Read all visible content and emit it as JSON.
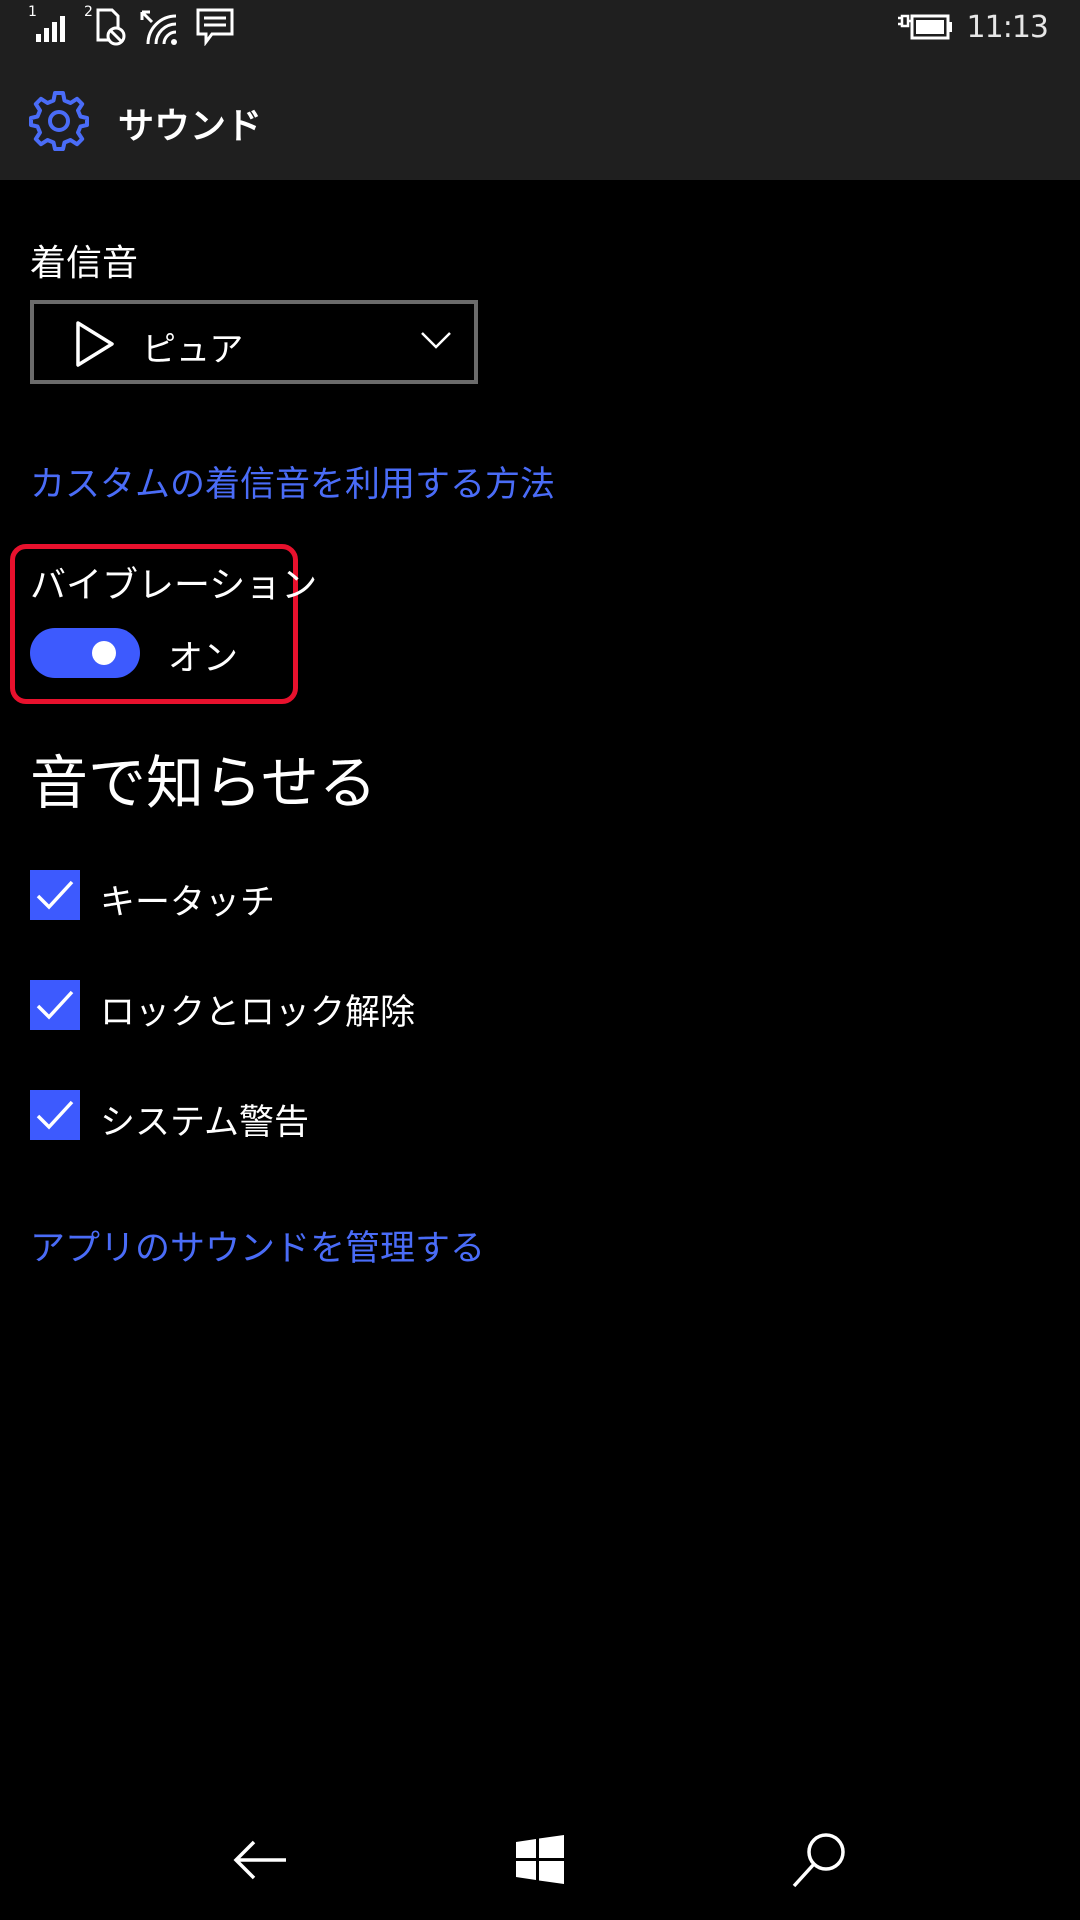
{
  "status_bar": {
    "sim1_label": "1",
    "sim2_label": "2",
    "time": "11:13",
    "icons": [
      "signal-icon",
      "sim2-no-service-icon",
      "wifi-icon",
      "message-icon",
      "battery-charging-icon"
    ]
  },
  "header": {
    "icon": "gear-icon",
    "title": "サウンド"
  },
  "ringtone": {
    "label": "着信音",
    "selected": "ピュア"
  },
  "custom_ringtone_link": "カスタムの着信音を利用する方法",
  "vibration": {
    "label": "バイブレーション",
    "state": "オン",
    "on": true
  },
  "sound_notifications": {
    "heading": "音で知らせる",
    "items": [
      {
        "label": "キータッチ",
        "checked": true
      },
      {
        "label": "ロックとロック解除",
        "checked": true
      },
      {
        "label": "システム警告",
        "checked": true
      }
    ]
  },
  "app_sounds_link": "アプリのサウンドを管理する",
  "nav_bar": {
    "icons": [
      "back-arrow-icon",
      "windows-start-icon",
      "search-icon"
    ]
  },
  "colors": {
    "accent": "#3d5afe",
    "link": "#4a6cf7",
    "highlight": "#e8112d",
    "header_bg": "#1f1f1f"
  }
}
